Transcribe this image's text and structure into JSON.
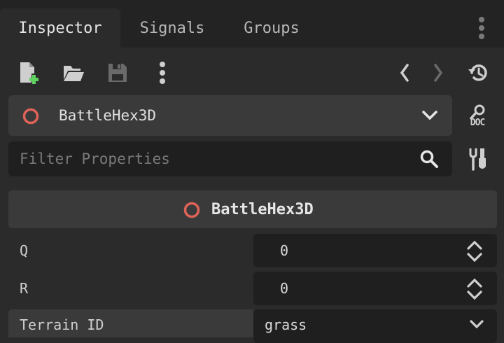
{
  "tabs": [
    {
      "label": "Inspector",
      "active": true
    },
    {
      "label": "Signals",
      "active": false
    },
    {
      "label": "Groups",
      "active": false
    }
  ],
  "toolbar": {
    "icons": [
      "new-resource-icon",
      "open-folder-icon",
      "save-icon",
      "kebab-menu-icon",
      "history-back-icon",
      "history-forward-icon",
      "object-history-icon"
    ]
  },
  "node_selector": {
    "name": "BattleHex3D"
  },
  "doc_icon_label": "DOC",
  "filter": {
    "placeholder": "Filter Properties",
    "value": ""
  },
  "section_header": {
    "title": "BattleHex3D"
  },
  "properties": [
    {
      "label": "Q",
      "value": "0"
    },
    {
      "label": "R",
      "value": "0"
    },
    {
      "label": "Terrain ID",
      "value": "grass"
    }
  ],
  "colors": {
    "node_ring": "#e06358",
    "new_plus": "#5fd35f",
    "icon_gray": "#cfcfcf",
    "icon_dim": "#6a6a6a"
  }
}
